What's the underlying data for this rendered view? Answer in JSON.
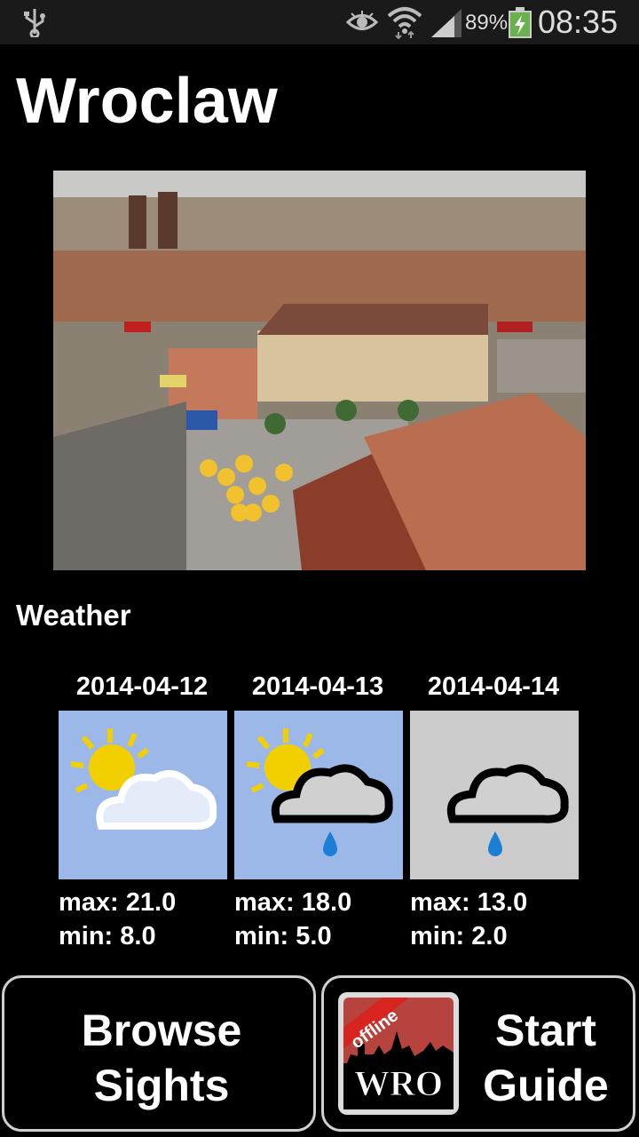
{
  "status_bar": {
    "battery_percent": "89%",
    "time": "08:35",
    "icons": [
      "usb-icon",
      "eye-icon",
      "wifi-icon",
      "signal-icon",
      "battery-charging-icon"
    ]
  },
  "page": {
    "title": "Wroclaw",
    "photo_alt": "aerial-view-market-square"
  },
  "weather": {
    "heading": "Weather",
    "days": [
      {
        "date": "2014-04-12",
        "max": "max: 21.0",
        "min": "min: 8.0",
        "icon": "sun-cloud-icon",
        "bg": "#9bb8e8"
      },
      {
        "date": "2014-04-13",
        "max": "max: 18.0",
        "min": "min: 5.0",
        "icon": "sun-rain-cloud-icon",
        "bg": "#9bb8e8"
      },
      {
        "date": "2014-04-14",
        "max": "max: 13.0",
        "min": "min: 2.0",
        "icon": "rain-cloud-icon",
        "bg": "#cccccc"
      }
    ]
  },
  "buttons": {
    "browse_line1": "Browse",
    "browse_line2": "Sights",
    "start_line1": "Start",
    "start_line2": "Guide",
    "logo_banner": "offline",
    "logo_text": "WRO"
  }
}
